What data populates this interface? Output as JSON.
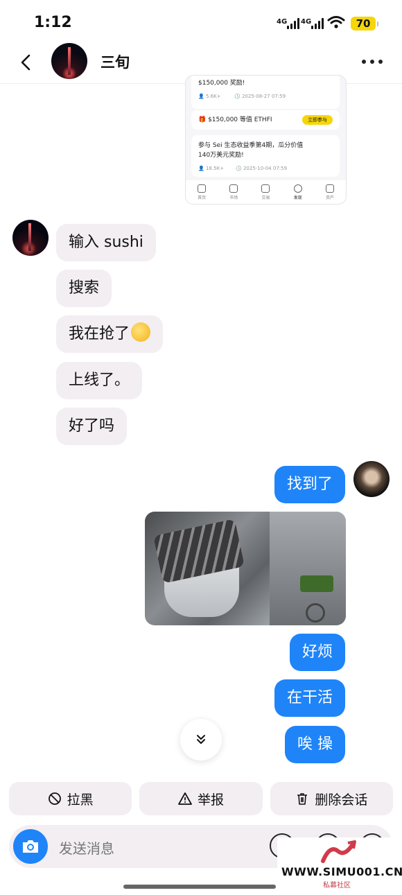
{
  "status_bar": {
    "time": "1:12",
    "signal1": "4G",
    "signal2": "4G",
    "battery": "70"
  },
  "header": {
    "title": "三旬"
  },
  "shared_card": {
    "item1_title": "$150,000 奖励!",
    "item1_views": "5.6K+",
    "item1_date": "2025-08-27 07:59",
    "reward_text": "$150,000 等值 ETHFI",
    "reward_button": "立即参与",
    "item2_title": "参与 Sei 生态收益季第4期，瓜分价值140万美元奖励!",
    "item2_views": "18.5K+",
    "item2_date": "2025-10-04 07:59",
    "nav": [
      "首页",
      "市场",
      "交易",
      "发现",
      "资产"
    ]
  },
  "messages": {
    "incoming": [
      {
        "text": "输入 sushi"
      },
      {
        "text": "搜索"
      },
      {
        "text": "我在抢了"
      },
      {
        "text": "上线了。"
      },
      {
        "text": "好了吗"
      }
    ],
    "outgoing": [
      {
        "text": "找到了"
      },
      {
        "text": "好烦"
      },
      {
        "text": "在干活"
      },
      {
        "text": "唉 操"
      }
    ]
  },
  "actions": {
    "block": "拉黑",
    "report": "举报",
    "delete": "删除会话"
  },
  "composer": {
    "placeholder": "发送消息"
  },
  "watermark": {
    "url": "WWW.SIMU001.CN",
    "sub": "私募社区"
  }
}
